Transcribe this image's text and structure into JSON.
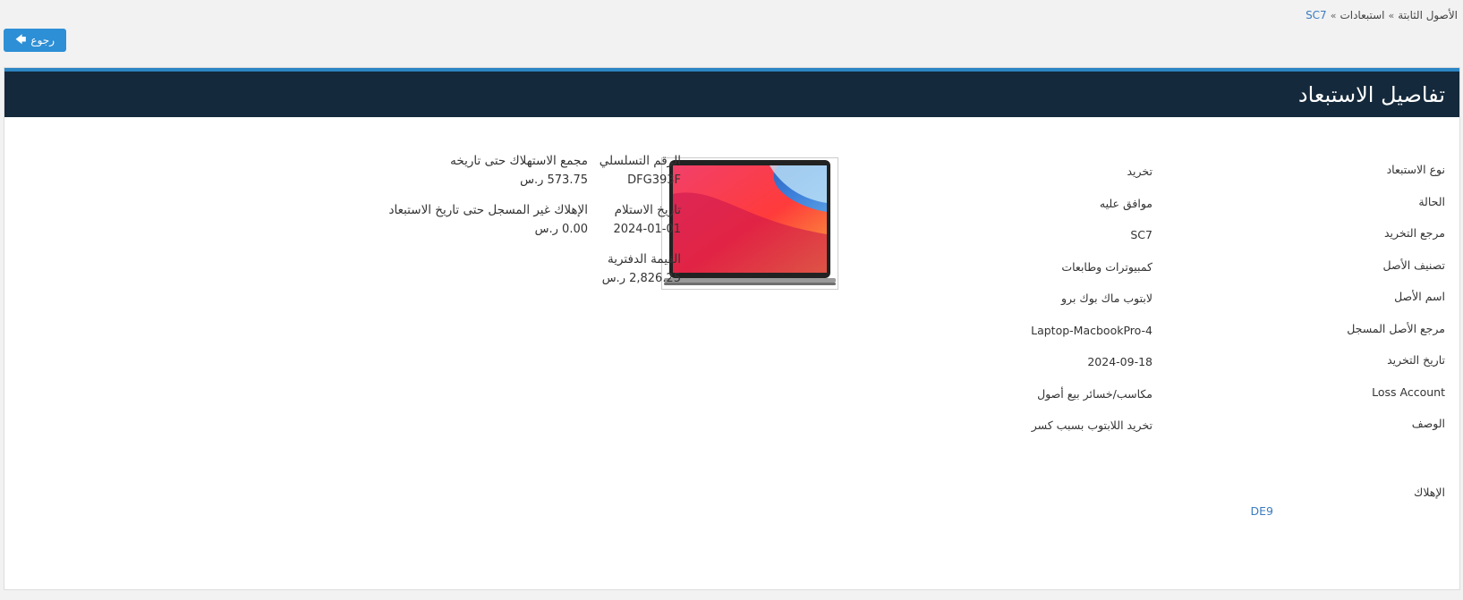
{
  "breadcrumb": {
    "items": [
      "الأصول الثابتة",
      "استبعادات",
      "SC7"
    ],
    "separator": "»"
  },
  "back_button": {
    "label": "رجوع",
    "icon": "arrow-left-icon"
  },
  "card": {
    "title": "تفاصيل الاستبعاد"
  },
  "details": [
    {
      "label": "نوع الاستبعاد",
      "value": "تخريد"
    },
    {
      "label": "الحالة",
      "value": "موافق عليه"
    },
    {
      "label": "مرجع التخريد",
      "value": "SC7"
    },
    {
      "label": "تصنيف الأصل",
      "value": "كمبيوترات وطابعات"
    },
    {
      "label": "اسم الأصل",
      "value": "لابتوب ماك بوك برو"
    },
    {
      "label": "مرجع الأصل المسجل",
      "value": "Laptop-MacbookPro-4"
    },
    {
      "label": "تاريخ التخريد",
      "value": "2024-09-18"
    },
    {
      "label": "Loss Account",
      "value": "مكاسب/خسائر بيع أصول"
    },
    {
      "label": "الوصف",
      "value": "تخريد اللابتوب بسبب كسر"
    }
  ],
  "depreciation": {
    "label": "الإهلاك",
    "value": "DE9"
  },
  "asset_image": {
    "alt": "laptop-image"
  },
  "stats": {
    "serial": {
      "label": "الرقم التسلسلي",
      "value": "DFG393F"
    },
    "received": {
      "label": "تاريخ الاستلام",
      "value": "2024-01-01"
    },
    "book_value": {
      "label": "القيمة الدفترية",
      "value": "2,826.25 ر.س"
    },
    "accum_dep": {
      "label": "مجمع الاستهلاك حتى تاريخه",
      "value": "573.75 ر.س"
    },
    "unrecorded_dep": {
      "label": "الإهلاك غير المسجل حتى تاريخ الاستبعاد",
      "value": "0.00 ر.س"
    }
  },
  "colors": {
    "header_bg": "#14293b",
    "header_accent": "#2c86c4",
    "button": "#2d8fd6",
    "link": "#3a7cc1"
  }
}
